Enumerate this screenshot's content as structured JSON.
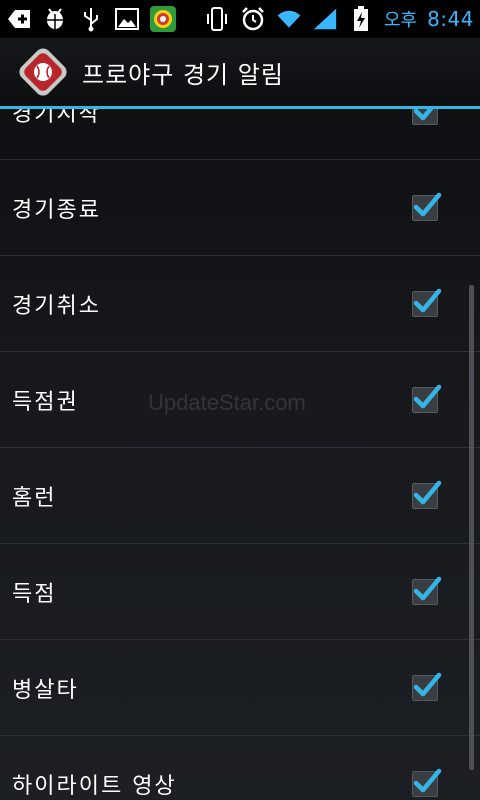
{
  "status_bar": {
    "icons_left": [
      "add-icon",
      "android-debug-icon",
      "usb-icon",
      "image-icon",
      "app-notification-icon"
    ],
    "icons_right": [
      "vibrate-icon",
      "alarm-icon",
      "wifi-icon",
      "signal-icon",
      "battery-charging-icon"
    ],
    "ampm": "오후",
    "time": "8:44",
    "accent_color": "#38b6ff"
  },
  "titlebar": {
    "title": "프로야구 경기 알림",
    "icon": "baseball-app-icon",
    "divider_color": "#33b5e5"
  },
  "list": {
    "items": [
      {
        "label": "경기시작",
        "checked": true
      },
      {
        "label": "경기종료",
        "checked": true
      },
      {
        "label": "경기취소",
        "checked": true
      },
      {
        "label": "득점권",
        "checked": true
      },
      {
        "label": "홈런",
        "checked": true
      },
      {
        "label": "득점",
        "checked": true
      },
      {
        "label": "병살타",
        "checked": true
      },
      {
        "label": "하이라이트 영상",
        "checked": true
      }
    ]
  },
  "watermark": "UpdateStar.com"
}
